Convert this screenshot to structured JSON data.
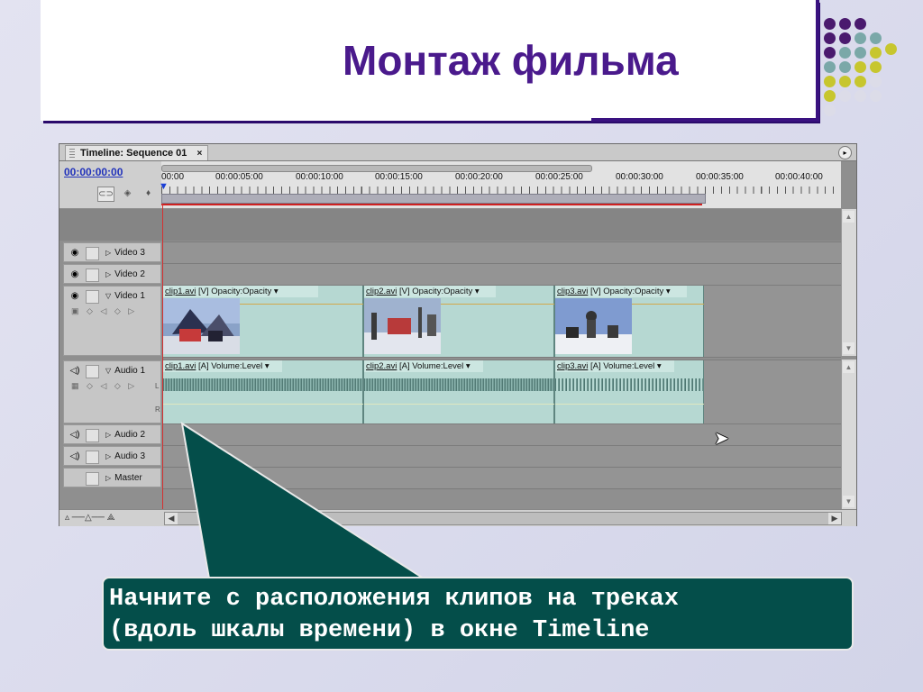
{
  "slide": {
    "title": "Монтаж фильма",
    "callout_text": "Начните с расположения клипов на треках\n(вдоль шкалы времени) в окне Timeline"
  },
  "colors": {
    "title": "#4a1a8c",
    "callout_bg": "#044e4a",
    "dot_purple": "#4a1a6e",
    "dot_teal": "#7aa8a8",
    "dot_yellow": "#c7c62e",
    "dot_light": "#dcdce8"
  },
  "timeline": {
    "tab_label": "Timeline: Sequence 01",
    "tab_close": "×",
    "timecode": "00:00:00:00",
    "header_icons": [
      "snap-icon",
      "marker-icon",
      "keyframe-icon"
    ],
    "ruler_labels": [
      "00:00",
      "00:00:05:00",
      "00:00:10:00",
      "00:00:15:00",
      "00:00:20:00",
      "00:00:25:00",
      "00:00:30:00",
      "00:00:35:00",
      "00:00:40:00"
    ],
    "tracks": {
      "video3": "Video 3",
      "video2": "Video 2",
      "video1": "Video 1",
      "audio1": "Audio 1",
      "audio2": "Audio 2",
      "audio3": "Audio 3",
      "master": "Master"
    },
    "channel_left": "L",
    "channel_right": "R",
    "video_clips": [
      {
        "name": "clip1.avi",
        "tag": " [V] ",
        "effect": "Opacity:Opacity ▾"
      },
      {
        "name": "clip2.avi",
        "tag": " [V] ",
        "effect": "Opacity:Opacity ▾"
      },
      {
        "name": "clip3.avi",
        "tag": " [V] ",
        "effect": "Opacity:Opacity ▾"
      }
    ],
    "audio_clips": [
      {
        "name": "clip1.avi",
        "tag": " [A] ",
        "effect": "Volume:Level ▾"
      },
      {
        "name": "clip2.avi",
        "tag": " [A] ",
        "effect": "Volume:Level ▾"
      },
      {
        "name": "clip3.avi",
        "tag": " [A] ",
        "effect": "Volume:Level ▾"
      }
    ]
  }
}
